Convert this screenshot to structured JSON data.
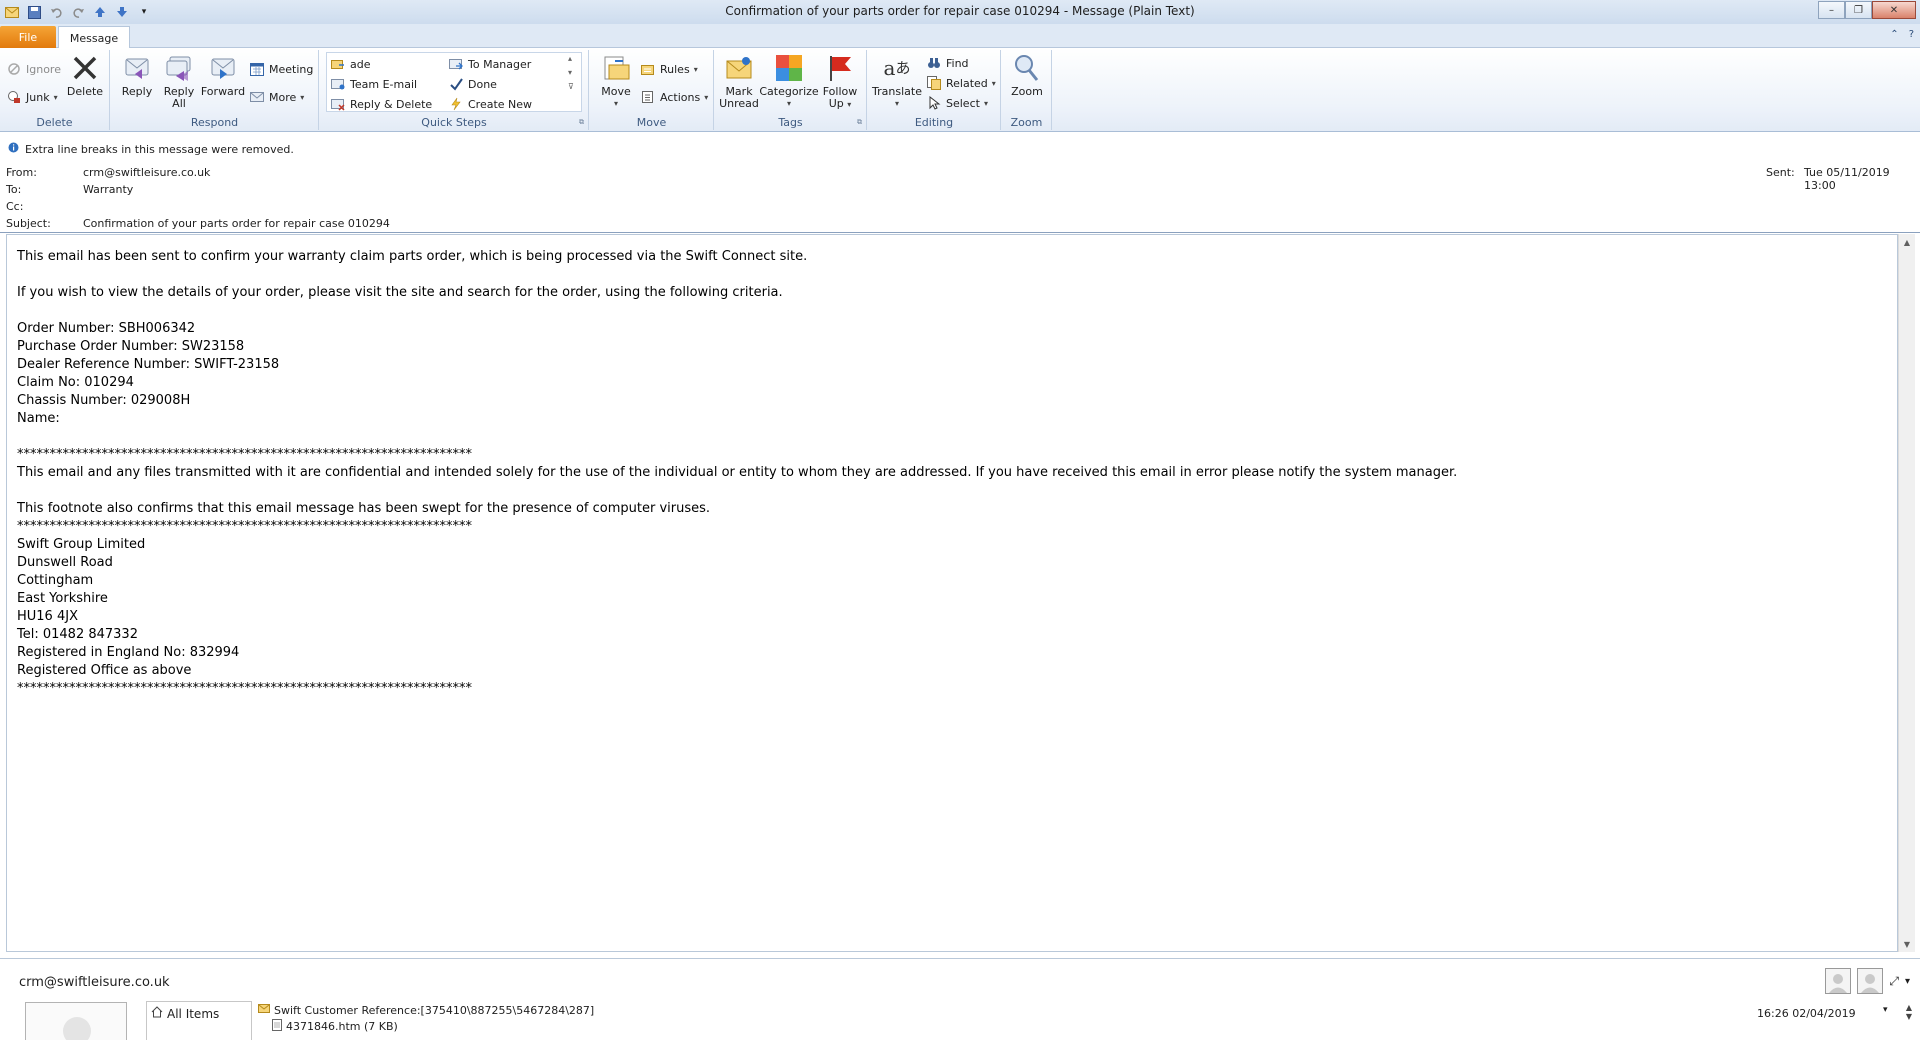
{
  "window": {
    "title": "Confirmation of your parts order for repair case 010294  -  Message (Plain Text)",
    "controls": {
      "minimize": "–",
      "restore": "❐",
      "close": "✕"
    }
  },
  "tabs": {
    "file": "File",
    "message": "Message"
  },
  "ribbon": {
    "delete": {
      "label": "Delete",
      "ignore": "Ignore",
      "junk": "Junk",
      "delete_btn": "Delete"
    },
    "respond": {
      "label": "Respond",
      "reply": "Reply",
      "reply_all_1": "Reply",
      "reply_all_2": "All",
      "forward": "Forward",
      "meeting": "Meeting",
      "more": "More"
    },
    "quick_steps": {
      "label": "Quick Steps",
      "items": [
        "ade",
        "Team E-mail",
        "Reply & Delete",
        "To Manager",
        "Done",
        "Create New"
      ]
    },
    "move": {
      "label": "Move",
      "move_btn": "Move",
      "rules": "Rules",
      "actions": "Actions"
    },
    "tags": {
      "label": "Tags",
      "mark_1": "Mark",
      "mark_2": "Unread",
      "categorize": "Categorize",
      "follow_1": "Follow",
      "follow_2": "Up"
    },
    "editing": {
      "label": "Editing",
      "translate": "Translate",
      "find": "Find",
      "related": "Related",
      "select": "Select"
    },
    "zoom": {
      "label": "Zoom",
      "zoom_btn": "Zoom"
    }
  },
  "header": {
    "info": "Extra line breaks in this message were removed.",
    "from_label": "From:",
    "from": "crm@swiftleisure.co.uk",
    "to_label": "To:",
    "to": "Warranty",
    "cc_label": "Cc:",
    "cc": "",
    "subject_label": "Subject:",
    "subject": "Confirmation of your parts order for repair case 010294",
    "sent_label": "Sent:",
    "sent": "Tue 05/11/2019 13:00"
  },
  "body": {
    "text": "This email has been sent to confirm your warranty claim parts order, which is being processed via the Swift Connect site.\n\nIf you wish to view the details of your order, please visit the site and search for the order, using the following criteria.\n\nOrder Number: SBH006342\nPurchase Order Number: SW23158\nDealer Reference Number: SWIFT-23158\nClaim No: 010294\nChassis Number: 029008H\nName:\n\n**********************************************************************\nThis email and any files transmitted with it are confidential and intended solely for the use of the individual or entity to whom they are addressed. If you have received this email in error please notify the system manager.\n\nThis footnote also confirms that this email message has been swept for the presence of computer viruses.\n**********************************************************************\nSwift Group Limited\nDunswell Road\nCottingham\nEast Yorkshire\nHU16 4JX\nTel: 01482 847332\nRegistered in England No: 832994\nRegistered Office as above\n**********************************************************************"
  },
  "people_pane": {
    "name": "crm@swiftleisure.co.uk",
    "nav_all_items": "All Items",
    "item_subject": "Swift Customer Reference:[375410\\887255\\5467284\\287]",
    "attachment": "4371846.htm (7 KB)",
    "item_date": "16:26  02/04/2019"
  },
  "colors": {
    "file_tab": "#e27a0d",
    "ribbon_bg": "#eef3fa",
    "group_label": "#3e5a80"
  }
}
